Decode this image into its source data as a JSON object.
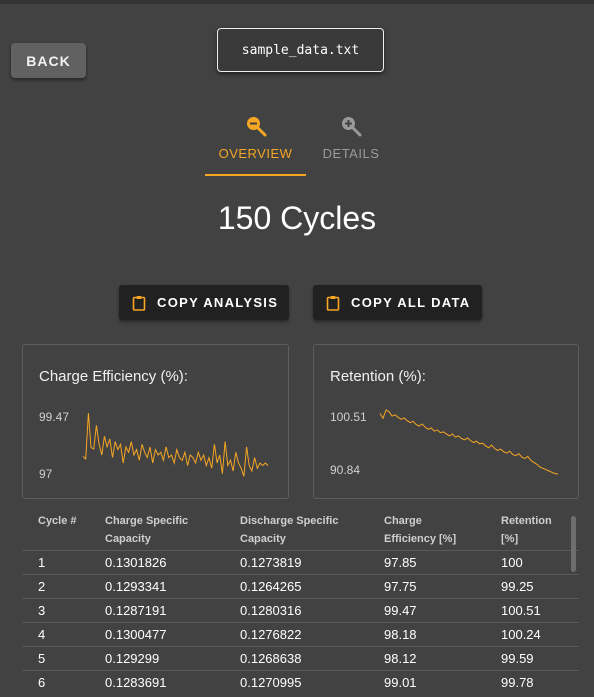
{
  "header": {
    "back_label": "BACK",
    "file_name": "sample_data.txt"
  },
  "tabs": [
    {
      "label": "OVERVIEW",
      "icon": "zoom-out-icon",
      "active": true
    },
    {
      "label": "DETAILS",
      "icon": "zoom-in-icon",
      "active": false
    }
  ],
  "summary": {
    "cycles_text": "150 Cycles"
  },
  "actions": {
    "copy_analysis": "COPY ANALYSIS",
    "copy_all_data": "COPY ALL DATA",
    "icon": "clipboard-icon"
  },
  "chart_data": [
    {
      "type": "line",
      "title": "Charge Efficiency (%):",
      "ymax_label": "99.47",
      "ymin_label": "97",
      "ylim": [
        97,
        99.47
      ],
      "color": "#f5a623",
      "x": [
        1,
        2,
        3,
        4,
        5,
        6,
        7,
        8,
        9,
        10,
        11,
        12,
        13,
        14,
        15,
        16,
        17,
        18,
        19,
        20,
        21,
        22,
        23,
        24,
        25,
        26,
        27,
        28,
        29,
        30,
        31,
        32,
        33,
        34,
        35,
        36,
        37,
        38,
        39,
        40,
        41,
        42,
        43,
        44,
        45,
        46,
        47,
        48,
        49,
        50,
        51,
        52,
        53,
        54,
        55,
        56,
        57,
        58,
        59,
        60,
        61,
        62,
        63,
        64,
        65,
        66,
        67,
        68,
        69,
        70
      ],
      "values": [
        97.85,
        97.75,
        99.47,
        98.18,
        98.12,
        99.01,
        98.3,
        97.9,
        98.6,
        98.2,
        98.5,
        97.8,
        98.4,
        98.1,
        98.3,
        97.6,
        98.2,
        98.0,
        98.4,
        97.9,
        98.1,
        97.7,
        98.3,
        98.0,
        97.8,
        98.2,
        97.6,
        98.1,
        97.9,
        98.0,
        97.7,
        98.2,
        97.8,
        97.9,
        97.6,
        98.1,
        97.8,
        97.7,
        98.0,
        97.5,
        97.9,
        97.8,
        97.6,
        98.0,
        97.7,
        97.9,
        97.5,
        97.8,
        97.4,
        98.3,
        97.6,
        97.9,
        97.2,
        98.4,
        97.5,
        97.7,
        97.3,
        98.0,
        97.6,
        97.4,
        97.1,
        98.2,
        97.5,
        97.3,
        97.8,
        97.4,
        97.6,
        97.5,
        97.6,
        97.5
      ]
    },
    {
      "type": "line",
      "title": "Retention (%):",
      "ymax_label": "100.51",
      "ymin_label": "90.84",
      "ylim": [
        90.84,
        100.51
      ],
      "color": "#f5a623",
      "x": [
        1,
        2,
        3,
        4,
        5,
        6,
        7,
        8,
        9,
        10,
        11,
        12,
        13,
        14,
        15,
        16,
        17,
        18,
        19,
        20,
        21,
        22,
        23,
        24,
        25,
        26,
        27,
        28,
        29,
        30,
        31,
        32,
        33,
        34,
        35,
        36,
        37,
        38,
        39,
        40,
        41,
        42,
        43,
        44,
        45,
        46,
        47,
        48,
        49,
        50,
        51,
        52,
        53,
        54,
        55,
        56,
        57,
        58,
        59,
        60
      ],
      "values": [
        100,
        99.25,
        100.51,
        100.24,
        99.59,
        99.78,
        99.4,
        99.1,
        99.3,
        98.9,
        98.6,
        98.8,
        98.3,
        98.1,
        98.4,
        97.9,
        97.6,
        97.8,
        97.3,
        97.5,
        97.1,
        97.2,
        96.9,
        96.6,
        96.9,
        96.4,
        96.6,
        96.2,
        96.0,
        96.3,
        95.9,
        95.6,
        95.8,
        95.4,
        95.5,
        95.1,
        94.8,
        95.2,
        94.7,
        94.4,
        94.6,
        94.2,
        94.0,
        94.3,
        93.8,
        93.6,
        93.9,
        93.4,
        93.2,
        93.5,
        92.9,
        92.6,
        92.3,
        91.9,
        91.7,
        91.5,
        91.3,
        91.1,
        90.9,
        90.84
      ]
    }
  ],
  "table": {
    "headers": [
      "Cycle #",
      "Charge Specific Capacity",
      "Discharge Specific Capacity",
      "Charge Efficiency [%]",
      "Retention [%]"
    ],
    "rows": [
      [
        "1",
        "0.1301826",
        "0.1273819",
        "97.85",
        "100"
      ],
      [
        "2",
        "0.1293341",
        "0.1264265",
        "97.75",
        "99.25"
      ],
      [
        "3",
        "0.1287191",
        "0.1280316",
        "99.47",
        "100.51"
      ],
      [
        "4",
        "0.1300477",
        "0.1276822",
        "98.18",
        "100.24"
      ],
      [
        "5",
        "0.129299",
        "0.1268638",
        "98.12",
        "99.59"
      ],
      [
        "6",
        "0.1283691",
        "0.1270995",
        "99.01",
        "99.78"
      ]
    ]
  }
}
